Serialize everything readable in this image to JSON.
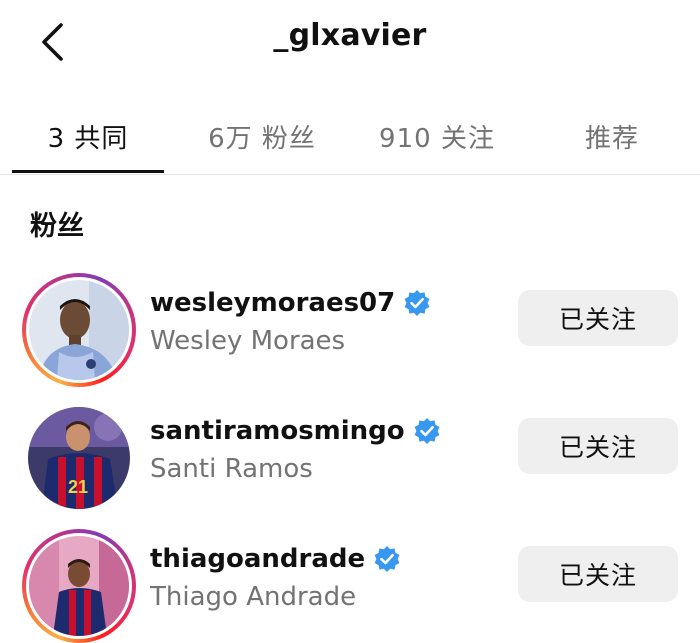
{
  "header": {
    "title": "_glxavier",
    "back_icon": "chevron-left-icon"
  },
  "tabs": [
    {
      "label": "3 共同",
      "active": true
    },
    {
      "label": "6万 粉丝",
      "active": false
    },
    {
      "label": "910 关注",
      "active": false
    },
    {
      "label": "推荐",
      "active": false
    }
  ],
  "section": {
    "title": "粉丝"
  },
  "users": [
    {
      "username": "wesleymoraes07",
      "full_name": "Wesley Moraes",
      "verified": true,
      "has_story_ring": true,
      "button_label": "已关注"
    },
    {
      "username": "santiramosmingo",
      "full_name": "Santi Ramos",
      "verified": true,
      "has_story_ring": false,
      "button_label": "已关注"
    },
    {
      "username": "thiagoandrade",
      "full_name": "Thiago Andrade",
      "verified": true,
      "has_story_ring": true,
      "button_label": "已关注"
    }
  ],
  "colors": {
    "verified_blue": "#3897f0",
    "button_bg": "#efefef",
    "secondary_text": "#737373"
  }
}
